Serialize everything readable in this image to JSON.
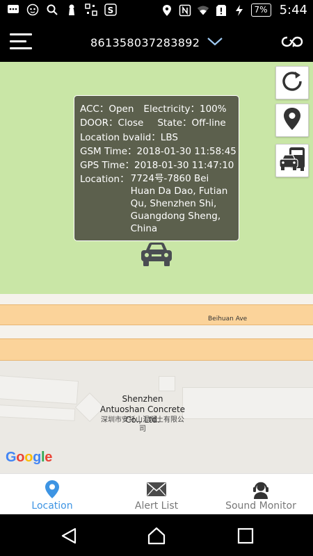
{
  "status_bar": {
    "battery": "7%",
    "time": "5:44",
    "icons": [
      "message-icon",
      "robot-icon",
      "search-icon",
      "keyhole-icon",
      "qr-icon",
      "app-s-icon",
      "location-pin-icon",
      "nfc-icon",
      "wifi-icon",
      "sim-alert-icon",
      "charging-icon"
    ]
  },
  "app_bar": {
    "device_id": "861358037283892",
    "menu_icon": "hamburger-menu-icon",
    "dropdown_icon": "chevron-down-icon",
    "sync_icon": "infinity-sync-icon"
  },
  "info_popup": {
    "acc_label": "ACC：",
    "acc_value": "Open",
    "electricity_label": "Electricity：",
    "electricity_value": "100%",
    "door_label": "DOOR：",
    "door_value": "Close",
    "state_label": "State：",
    "state_value": "Off-line",
    "location_valid_label": "Location bvalid：",
    "location_valid_value": "LBS",
    "gsm_time_label": "GSM Time：",
    "gsm_time_value": "2018-01-30 11:58:45",
    "gps_time_label": "GPS Time：",
    "gps_time_value": "2018-01-30 11:47:10",
    "location_label": "Location：",
    "location_value": "7724号-7860 Bei Huan Da Dao, Futian Qu, Shenzhen Shi, Guangdong Sheng, China"
  },
  "map": {
    "street_label": "Beihuan Ave",
    "poi_name_en": "Shenzhen Antuoshan Concrete Co., Ltd.",
    "poi_name_cn": "深圳市安托山混凝土有限公司",
    "google_logo": "Google",
    "colors": {
      "park": "#c9e6a6",
      "road": "#fbd39a",
      "land": "#ebe9e4",
      "popup": "#5c604d"
    }
  },
  "side_buttons": [
    {
      "icon": "refresh-icon"
    },
    {
      "icon": "map-pin-icon"
    },
    {
      "icon": "traffic-icon"
    }
  ],
  "bottom_nav": {
    "items": [
      {
        "label": "Location",
        "icon": "location-pin-icon",
        "active": true
      },
      {
        "label": "Alert List",
        "icon": "envelope-icon",
        "active": false
      },
      {
        "label": "Sound Monitor",
        "icon": "headset-person-icon",
        "active": false
      }
    ],
    "active_color": "#3d94e3"
  },
  "system_nav": {
    "icons": [
      "back-icon",
      "home-icon",
      "recents-icon"
    ]
  }
}
